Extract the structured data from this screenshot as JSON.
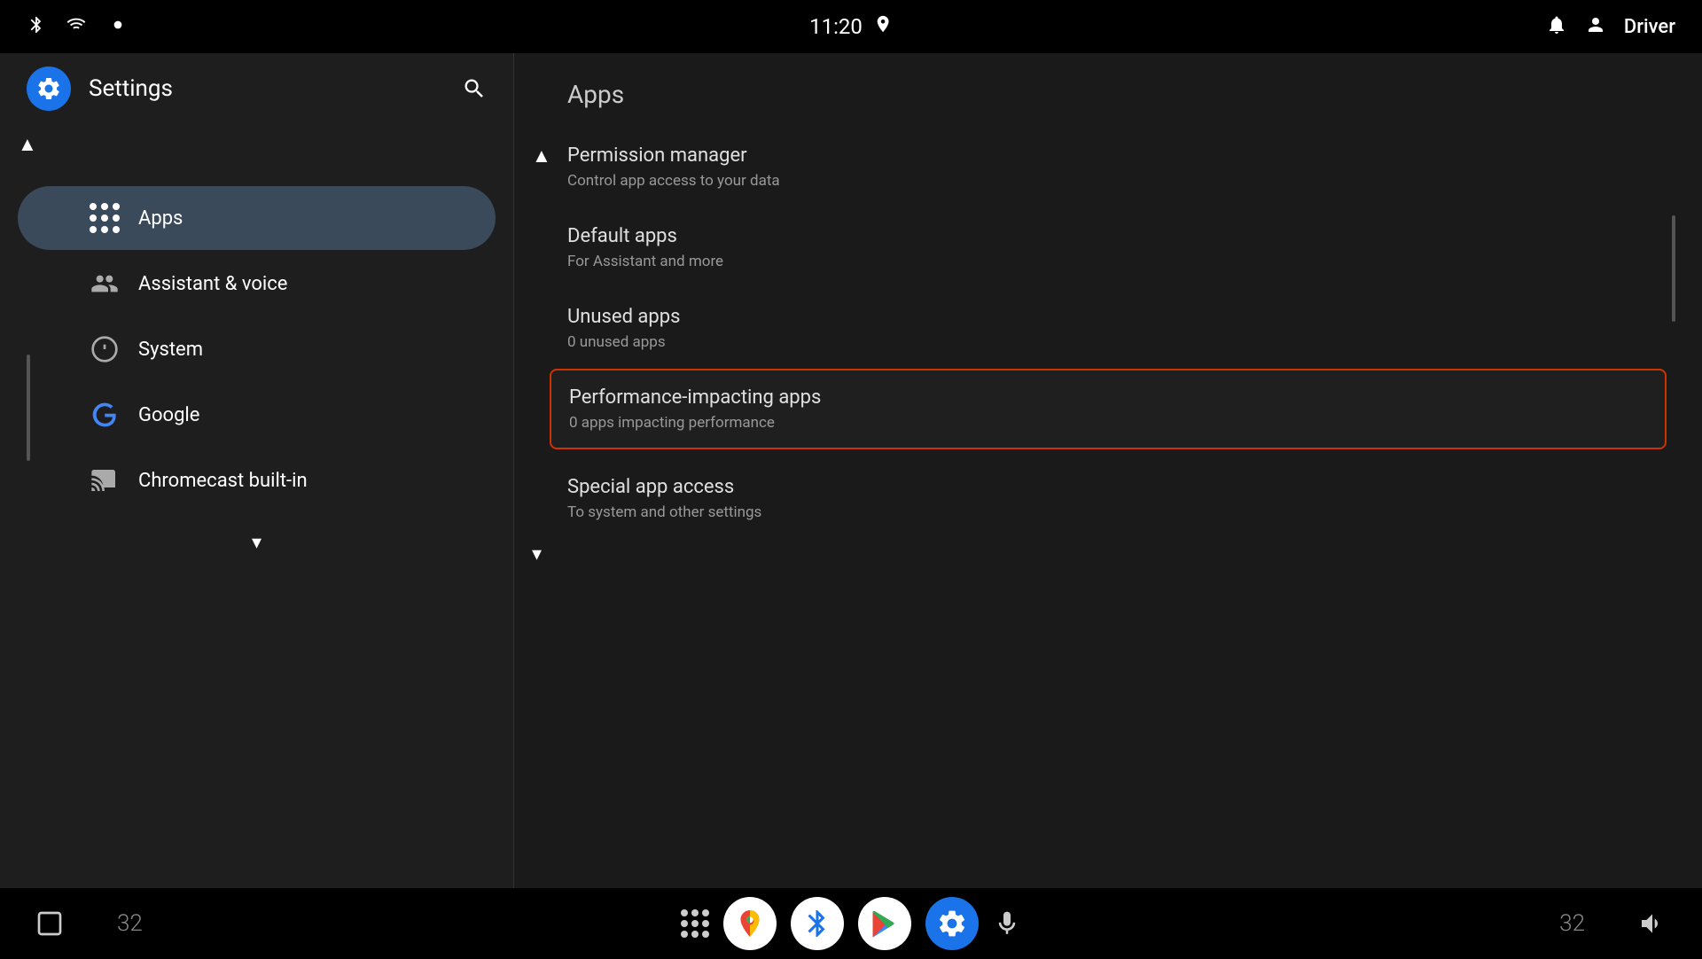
{
  "statusBar": {
    "time": "11:20",
    "user": "Driver"
  },
  "sidebar": {
    "title": "Settings",
    "items": [
      {
        "id": "apps",
        "label": "Apps",
        "icon": "grid-dots",
        "active": true
      },
      {
        "id": "assistant-voice",
        "label": "Assistant & voice",
        "icon": "assistant"
      },
      {
        "id": "system",
        "label": "System",
        "icon": "info-circle"
      },
      {
        "id": "google",
        "label": "Google",
        "icon": "google-g"
      },
      {
        "id": "chromecast",
        "label": "Chromecast built-in",
        "icon": "cast"
      }
    ]
  },
  "content": {
    "title": "Apps",
    "menuItems": [
      {
        "id": "permission-manager",
        "title": "Permission manager",
        "subtitle": "Control app access to your data",
        "selected": false
      },
      {
        "id": "default-apps",
        "title": "Default apps",
        "subtitle": "For Assistant and more",
        "selected": false
      },
      {
        "id": "unused-apps",
        "title": "Unused apps",
        "subtitle": "0 unused apps",
        "selected": false
      },
      {
        "id": "performance-impacting-apps",
        "title": "Performance-impacting apps",
        "subtitle": "0 apps impacting performance",
        "selected": true
      },
      {
        "id": "special-app-access",
        "title": "Special app access",
        "subtitle": "To system and other settings",
        "selected": false
      }
    ]
  },
  "bottomNav": {
    "leftNum": "32",
    "rightNum": "32"
  }
}
